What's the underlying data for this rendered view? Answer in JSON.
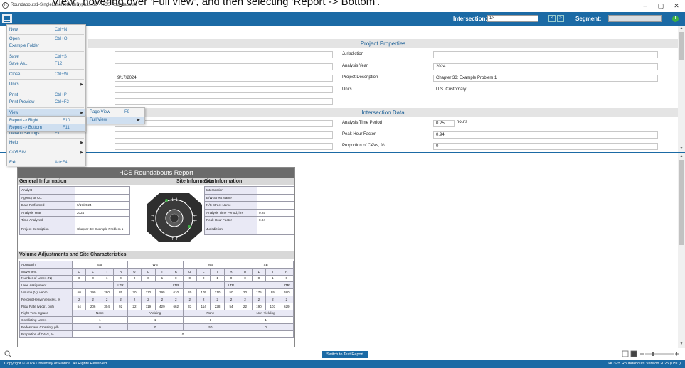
{
  "window": {
    "title": "Roundabouts1-SingleLaneRbtWithBypass.xro - HCS Roundabouts",
    "overlay_text": "'View', hovering over 'Full view', and then selecting 'Report -> Bottom'.",
    "minimize": "–",
    "maximize": "▢",
    "close": "✕"
  },
  "header": {
    "intersection_label": "Intersection:",
    "intersection_value": "1>",
    "segment_label": "Segment:",
    "prev": "<",
    "next": ">"
  },
  "file_menu": {
    "items": [
      {
        "label": "New",
        "shortcut": "Ctrl+N"
      },
      {
        "label": "Open",
        "shortcut": "Ctrl+O"
      },
      {
        "label": "Example Folder",
        "shortcut": ""
      },
      {
        "label": "Save",
        "shortcut": "Ctrl+S"
      },
      {
        "label": "Save As...",
        "shortcut": "F12"
      },
      {
        "label": "Close",
        "shortcut": "Ctrl+W"
      },
      {
        "label": "Units",
        "shortcut": ""
      },
      {
        "label": "Print",
        "shortcut": "Ctrl+P"
      },
      {
        "label": "Print Preview",
        "shortcut": "Ctrl+F2"
      },
      {
        "label": "View",
        "shortcut": ""
      },
      {
        "label": "Default Settings",
        "shortcut": "F1"
      },
      {
        "label": "Help",
        "shortcut": ""
      },
      {
        "label": "CORSIM",
        "shortcut": ""
      },
      {
        "label": "Exit",
        "shortcut": "Alt+F4"
      }
    ]
  },
  "view_submenu": {
    "items": [
      {
        "label": "Page View",
        "shortcut": "F9"
      },
      {
        "label": "Full View",
        "shortcut": ""
      }
    ]
  },
  "full_view_submenu": {
    "items": [
      {
        "label": "Report -> Right",
        "shortcut": "F10"
      },
      {
        "label": "Report -> Bottom",
        "shortcut": "F11"
      }
    ]
  },
  "project_properties": {
    "title": "Project Properties",
    "left_values": [
      "",
      "",
      "9/17/2024",
      "",
      ""
    ],
    "labels": [
      "Jurisdiction",
      "Analysis Year",
      "Project Description",
      "Units"
    ],
    "values": [
      "",
      "2024",
      "Chapter 33: Example Problem 1",
      "U.S. Customary"
    ]
  },
  "intersection_data": {
    "title": "Intersection Data",
    "labels": [
      "Analysis Time Period",
      "Peak Hour Factor",
      "Proportion of CAVs, %"
    ],
    "values": [
      "0.25",
      "0.94",
      "0"
    ],
    "unit": "hours"
  },
  "report": {
    "title": "HCS Roundabouts Report",
    "general_info_heading": "General Information",
    "site_info_heading": "Site Information",
    "general_rows": [
      {
        "label": "Analyst",
        "value": ""
      },
      {
        "label": "Agency or Co.",
        "value": ""
      },
      {
        "label": "Date Performed",
        "value": "9/17/2024"
      },
      {
        "label": "Analysis Year",
        "value": "2024"
      },
      {
        "label": "Time Analyzed",
        "value": ""
      },
      {
        "label": "Project Description",
        "value": "Chapter 33: Example Problem 1"
      }
    ],
    "site_rows": [
      {
        "label": "Intersection",
        "value": ""
      },
      {
        "label": "E/W Street Name",
        "value": ""
      },
      {
        "label": "N/S Street Name",
        "value": ""
      },
      {
        "label": "Analysis Time Period, hrs",
        "value": "0.25"
      },
      {
        "label": "Peak Hour Factor",
        "value": "0.94"
      },
      {
        "label": "Jurisdiction",
        "value": ""
      }
    ],
    "volume_heading": "Volume Adjustments and Site Characteristics",
    "approach_label": "Approach",
    "approaches": [
      "EB",
      "WB",
      "NB",
      "SB"
    ],
    "movement_label": "Movement",
    "movements": [
      "U",
      "L",
      "T",
      "R"
    ],
    "rows": [
      {
        "label": "Number of Lanes (N)",
        "cells": [
          "0",
          "0",
          "1",
          "0",
          "0",
          "0",
          "1",
          "0",
          "0",
          "0",
          "1",
          "0",
          "0",
          "0",
          "1",
          "0"
        ]
      },
      {
        "label": "Lane Assignment",
        "groups": [
          "LTR",
          "LTR",
          "LTR",
          "LTR"
        ]
      },
      {
        "label": "Volume (V), veh/h",
        "cells": [
          "50",
          "190",
          "280",
          "85",
          "20",
          "110",
          "395",
          "610",
          "30",
          "105",
          "210",
          "50",
          "20",
          "175",
          "95",
          "580"
        ]
      },
      {
        "label": "Percent Heavy Vehicles, %",
        "cells": [
          "2",
          "2",
          "2",
          "2",
          "2",
          "2",
          "2",
          "2",
          "2",
          "2",
          "2",
          "2",
          "2",
          "2",
          "2",
          "2"
        ]
      },
      {
        "label": "Flow Rate (vpcp), pc/h",
        "cells": [
          "54",
          "206",
          "304",
          "92",
          "22",
          "119",
          "429",
          "662",
          "33",
          "114",
          "228",
          "54",
          "22",
          "190",
          "103",
          "629"
        ]
      },
      {
        "label": "Right-Turn Bypass",
        "groups": [
          "None",
          "Yielding",
          "None",
          "Non-Yielding"
        ]
      },
      {
        "label": "Conflicting Lanes",
        "groups": [
          "1",
          "1",
          "1",
          "1"
        ]
      },
      {
        "label": "Pedestrians Crossing, p/h",
        "groups": [
          "0",
          "0",
          "50",
          "0"
        ]
      },
      {
        "label": "Proportion of CAVs, %",
        "span": "0"
      }
    ]
  },
  "switch_button": "Switch to Text Report",
  "status": {
    "copyright": "Copyright © 2024 University of Florida. All Rights Reserved.",
    "version": "HCS™ Roundabouts Version 2025 (USC)"
  }
}
